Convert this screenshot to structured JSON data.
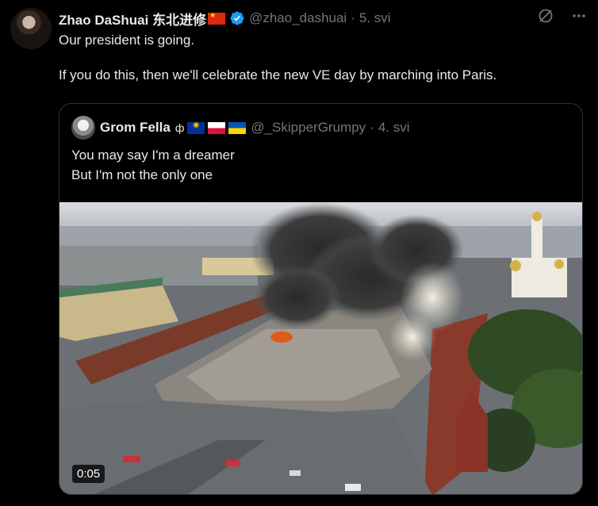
{
  "post": {
    "author_name": "Zhao DaShuai 东北进修",
    "author_flag_icon": "china-flag-icon",
    "verified_icon": "verified-badge-icon",
    "handle": "@zhao_dashuai",
    "separator": "·",
    "time": "5. svi",
    "text_line1": "Our president is going.",
    "text_line2": "If you do this, then we'll celebrate the new VE day by marching into Paris."
  },
  "quoted": {
    "author_name": "Grom Fella",
    "emoji_icons": [
      "symbol-icon",
      "eu-flag-icon",
      "poland-flag-icon",
      "ukraine-flag-icon"
    ],
    "emoji_symbol": "ф",
    "handle": "@_SkipperGrumpy",
    "separator": "·",
    "time": "4. svi",
    "text_line1": "You may say I'm a dreamer",
    "text_line2": "But I'm not the only one",
    "video_duration": "0:05"
  },
  "colors": {
    "background": "#000000",
    "text": "#e7e9ea",
    "muted": "#71767b",
    "border": "#2f3336",
    "verified": "#1d9bf0"
  }
}
